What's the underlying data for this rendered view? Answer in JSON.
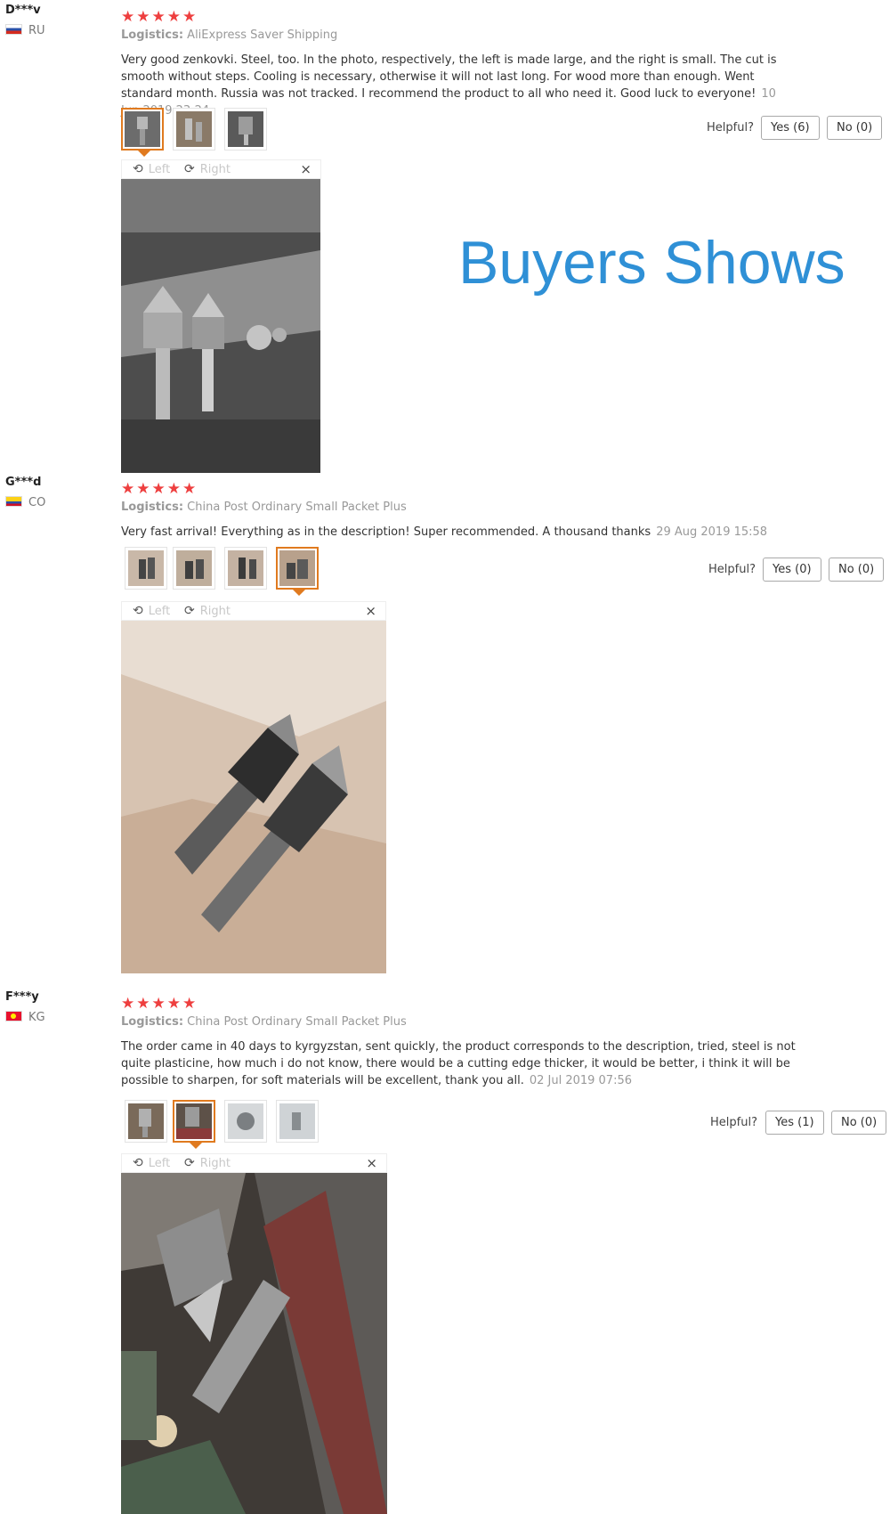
{
  "banner": {
    "title": "Buyers Shows"
  },
  "viewer_controls": {
    "left": "Left",
    "right": "Right",
    "close": "×"
  },
  "helpful_label": "Helpful?",
  "reviews": [
    {
      "user": "D***v",
      "country": "RU",
      "stars": "★★★★★",
      "logistics_label": "Logistics:",
      "logistics": "AliExpress Saver Shipping",
      "text": "Very good zenkovki. Steel, too. In the photo, respectively, the left is made large, and the right is small. The cut is smooth without steps. Cooling is necessary, otherwise it will not last long. For wood more than enough. Went standard month. Russia was not tracked. I recommend the product to all who need it. Good luck to everyone!",
      "date": "10 Jun 2019 23:24",
      "yes": "Yes (6)",
      "no": "No (0)"
    },
    {
      "user": "G***d",
      "country": "CO",
      "stars": "★★★★★",
      "logistics_label": "Logistics:",
      "logistics": "China Post Ordinary Small Packet Plus",
      "text": "Very fast arrival! Everything as in the description! Super recommended. A thousand thanks",
      "date": "29 Aug 2019 15:58",
      "yes": "Yes (0)",
      "no": "No (0)"
    },
    {
      "user": "F***y",
      "country": "KG",
      "stars": "★★★★★",
      "logistics_label": "Logistics:",
      "logistics": "China Post Ordinary Small Packet Plus",
      "text": "The order came in 40 days to kyrgyzstan, sent quickly, the product corresponds to the description, tried, steel is not quite plasticine, how much i do not know, there would be a cutting edge thicker, it would be better, i think it will be possible to sharpen, for soft materials will be excellent, thank you all.",
      "date": "02 Jul 2019 07:56",
      "yes": "Yes (1)",
      "no": "No (0)"
    }
  ]
}
